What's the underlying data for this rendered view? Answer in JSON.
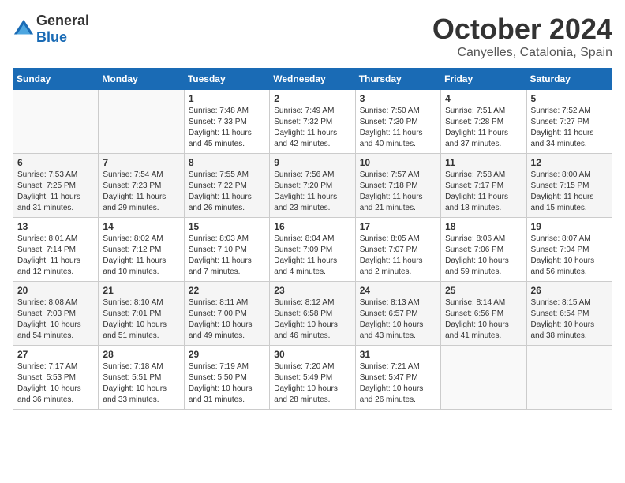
{
  "logo": {
    "text_general": "General",
    "text_blue": "Blue"
  },
  "title": "October 2024",
  "subtitle": "Canyelles, Catalonia, Spain",
  "days_header": [
    "Sunday",
    "Monday",
    "Tuesday",
    "Wednesday",
    "Thursday",
    "Friday",
    "Saturday"
  ],
  "weeks": [
    [
      {
        "day": "",
        "sunrise": "",
        "sunset": "",
        "daylight": ""
      },
      {
        "day": "",
        "sunrise": "",
        "sunset": "",
        "daylight": ""
      },
      {
        "day": "1",
        "sunrise": "Sunrise: 7:48 AM",
        "sunset": "Sunset: 7:33 PM",
        "daylight": "Daylight: 11 hours and 45 minutes."
      },
      {
        "day": "2",
        "sunrise": "Sunrise: 7:49 AM",
        "sunset": "Sunset: 7:32 PM",
        "daylight": "Daylight: 11 hours and 42 minutes."
      },
      {
        "day": "3",
        "sunrise": "Sunrise: 7:50 AM",
        "sunset": "Sunset: 7:30 PM",
        "daylight": "Daylight: 11 hours and 40 minutes."
      },
      {
        "day": "4",
        "sunrise": "Sunrise: 7:51 AM",
        "sunset": "Sunset: 7:28 PM",
        "daylight": "Daylight: 11 hours and 37 minutes."
      },
      {
        "day": "5",
        "sunrise": "Sunrise: 7:52 AM",
        "sunset": "Sunset: 7:27 PM",
        "daylight": "Daylight: 11 hours and 34 minutes."
      }
    ],
    [
      {
        "day": "6",
        "sunrise": "Sunrise: 7:53 AM",
        "sunset": "Sunset: 7:25 PM",
        "daylight": "Daylight: 11 hours and 31 minutes."
      },
      {
        "day": "7",
        "sunrise": "Sunrise: 7:54 AM",
        "sunset": "Sunset: 7:23 PM",
        "daylight": "Daylight: 11 hours and 29 minutes."
      },
      {
        "day": "8",
        "sunrise": "Sunrise: 7:55 AM",
        "sunset": "Sunset: 7:22 PM",
        "daylight": "Daylight: 11 hours and 26 minutes."
      },
      {
        "day": "9",
        "sunrise": "Sunrise: 7:56 AM",
        "sunset": "Sunset: 7:20 PM",
        "daylight": "Daylight: 11 hours and 23 minutes."
      },
      {
        "day": "10",
        "sunrise": "Sunrise: 7:57 AM",
        "sunset": "Sunset: 7:18 PM",
        "daylight": "Daylight: 11 hours and 21 minutes."
      },
      {
        "day": "11",
        "sunrise": "Sunrise: 7:58 AM",
        "sunset": "Sunset: 7:17 PM",
        "daylight": "Daylight: 11 hours and 18 minutes."
      },
      {
        "day": "12",
        "sunrise": "Sunrise: 8:00 AM",
        "sunset": "Sunset: 7:15 PM",
        "daylight": "Daylight: 11 hours and 15 minutes."
      }
    ],
    [
      {
        "day": "13",
        "sunrise": "Sunrise: 8:01 AM",
        "sunset": "Sunset: 7:14 PM",
        "daylight": "Daylight: 11 hours and 12 minutes."
      },
      {
        "day": "14",
        "sunrise": "Sunrise: 8:02 AM",
        "sunset": "Sunset: 7:12 PM",
        "daylight": "Daylight: 11 hours and 10 minutes."
      },
      {
        "day": "15",
        "sunrise": "Sunrise: 8:03 AM",
        "sunset": "Sunset: 7:10 PM",
        "daylight": "Daylight: 11 hours and 7 minutes."
      },
      {
        "day": "16",
        "sunrise": "Sunrise: 8:04 AM",
        "sunset": "Sunset: 7:09 PM",
        "daylight": "Daylight: 11 hours and 4 minutes."
      },
      {
        "day": "17",
        "sunrise": "Sunrise: 8:05 AM",
        "sunset": "Sunset: 7:07 PM",
        "daylight": "Daylight: 11 hours and 2 minutes."
      },
      {
        "day": "18",
        "sunrise": "Sunrise: 8:06 AM",
        "sunset": "Sunset: 7:06 PM",
        "daylight": "Daylight: 10 hours and 59 minutes."
      },
      {
        "day": "19",
        "sunrise": "Sunrise: 8:07 AM",
        "sunset": "Sunset: 7:04 PM",
        "daylight": "Daylight: 10 hours and 56 minutes."
      }
    ],
    [
      {
        "day": "20",
        "sunrise": "Sunrise: 8:08 AM",
        "sunset": "Sunset: 7:03 PM",
        "daylight": "Daylight: 10 hours and 54 minutes."
      },
      {
        "day": "21",
        "sunrise": "Sunrise: 8:10 AM",
        "sunset": "Sunset: 7:01 PM",
        "daylight": "Daylight: 10 hours and 51 minutes."
      },
      {
        "day": "22",
        "sunrise": "Sunrise: 8:11 AM",
        "sunset": "Sunset: 7:00 PM",
        "daylight": "Daylight: 10 hours and 49 minutes."
      },
      {
        "day": "23",
        "sunrise": "Sunrise: 8:12 AM",
        "sunset": "Sunset: 6:58 PM",
        "daylight": "Daylight: 10 hours and 46 minutes."
      },
      {
        "day": "24",
        "sunrise": "Sunrise: 8:13 AM",
        "sunset": "Sunset: 6:57 PM",
        "daylight": "Daylight: 10 hours and 43 minutes."
      },
      {
        "day": "25",
        "sunrise": "Sunrise: 8:14 AM",
        "sunset": "Sunset: 6:56 PM",
        "daylight": "Daylight: 10 hours and 41 minutes."
      },
      {
        "day": "26",
        "sunrise": "Sunrise: 8:15 AM",
        "sunset": "Sunset: 6:54 PM",
        "daylight": "Daylight: 10 hours and 38 minutes."
      }
    ],
    [
      {
        "day": "27",
        "sunrise": "Sunrise: 7:17 AM",
        "sunset": "Sunset: 5:53 PM",
        "daylight": "Daylight: 10 hours and 36 minutes."
      },
      {
        "day": "28",
        "sunrise": "Sunrise: 7:18 AM",
        "sunset": "Sunset: 5:51 PM",
        "daylight": "Daylight: 10 hours and 33 minutes."
      },
      {
        "day": "29",
        "sunrise": "Sunrise: 7:19 AM",
        "sunset": "Sunset: 5:50 PM",
        "daylight": "Daylight: 10 hours and 31 minutes."
      },
      {
        "day": "30",
        "sunrise": "Sunrise: 7:20 AM",
        "sunset": "Sunset: 5:49 PM",
        "daylight": "Daylight: 10 hours and 28 minutes."
      },
      {
        "day": "31",
        "sunrise": "Sunrise: 7:21 AM",
        "sunset": "Sunset: 5:47 PM",
        "daylight": "Daylight: 10 hours and 26 minutes."
      },
      {
        "day": "",
        "sunrise": "",
        "sunset": "",
        "daylight": ""
      },
      {
        "day": "",
        "sunrise": "",
        "sunset": "",
        "daylight": ""
      }
    ]
  ]
}
